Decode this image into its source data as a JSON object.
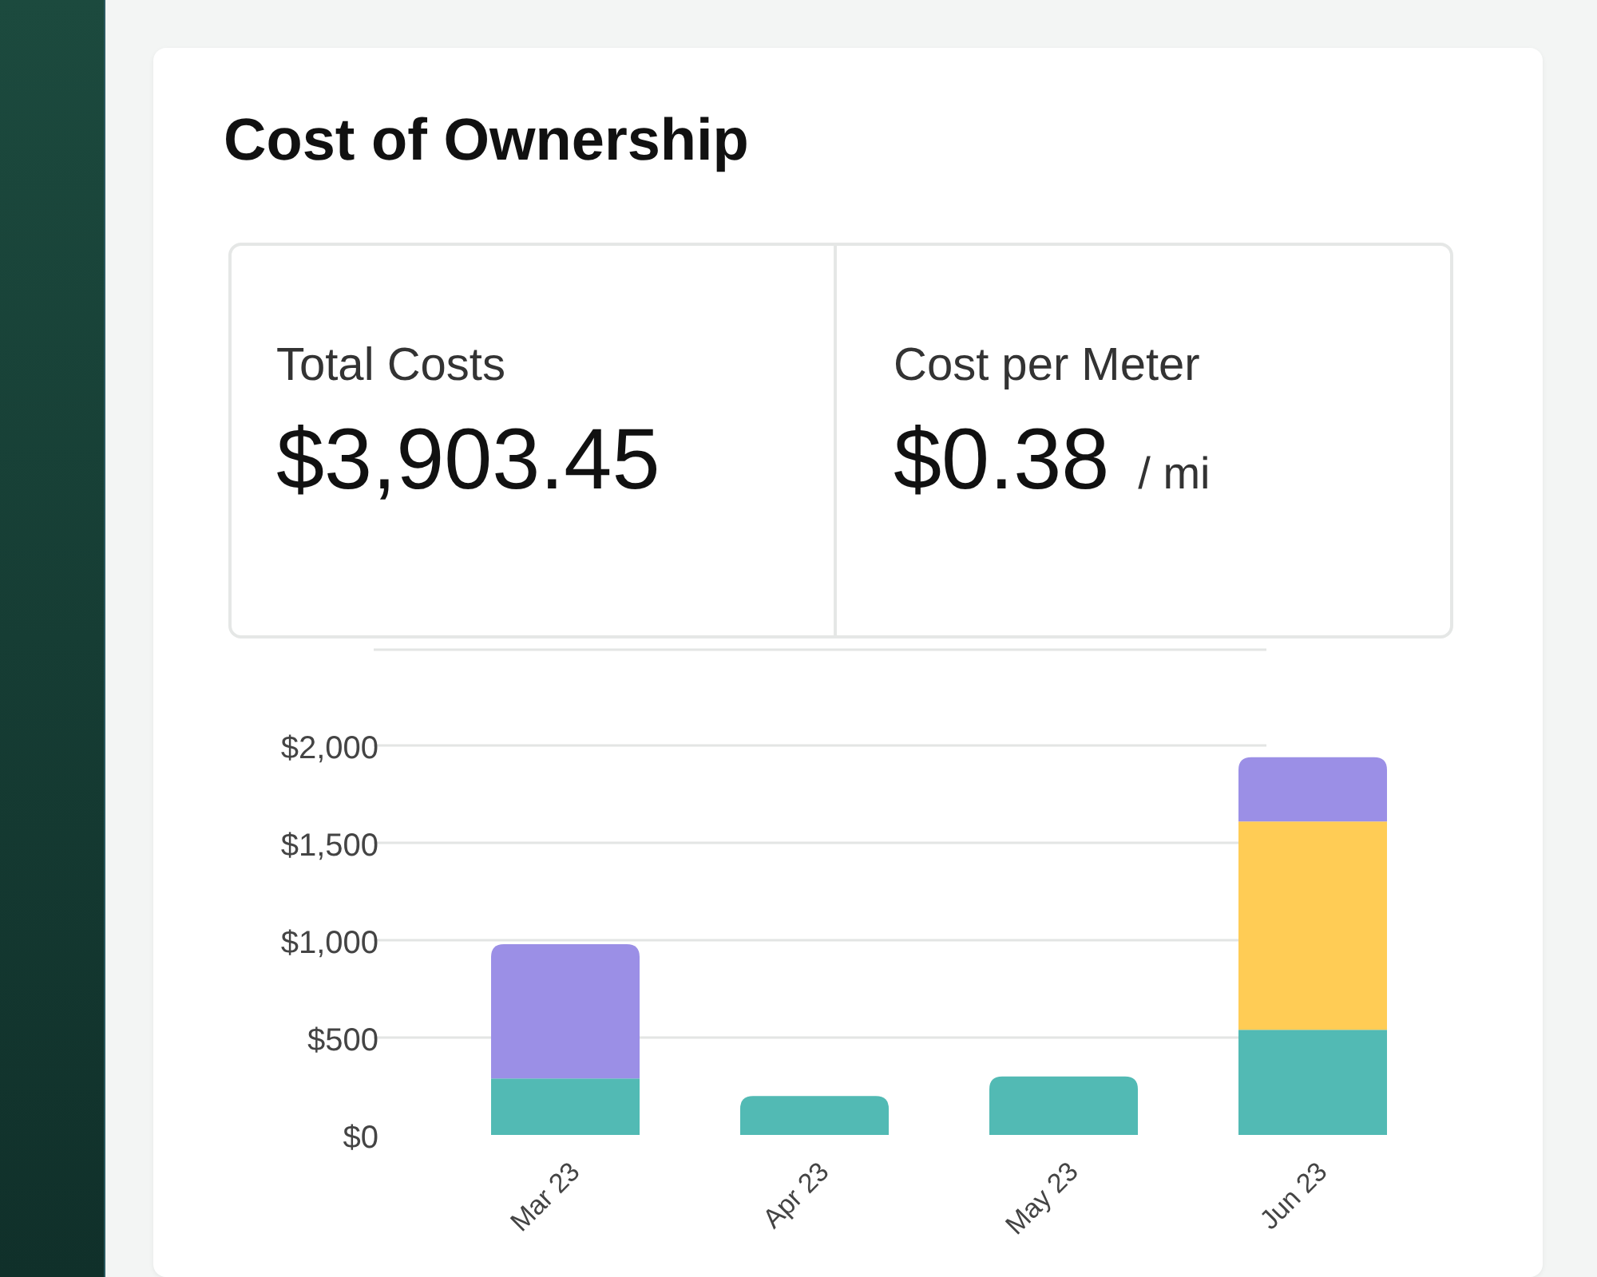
{
  "card": {
    "title": "Cost of Ownership",
    "stats": [
      {
        "label": "Total Costs",
        "value": "$3,903.45"
      },
      {
        "label": "Cost per Meter",
        "value": "$0.38",
        "unit": "/ mi"
      }
    ],
    "chart_data": {
      "type": "bar",
      "stacked": true,
      "categories": [
        "Mar 23",
        "Apr 23",
        "May 23",
        "Jun 23"
      ],
      "series": [
        {
          "color": "#52bab4",
          "values": [
            290,
            200,
            300,
            540
          ]
        },
        {
          "color": "#ffcc55",
          "values": [
            0,
            0,
            0,
            1070
          ]
        },
        {
          "color": "#9b8fe6",
          "values": [
            690,
            0,
            0,
            330
          ]
        }
      ],
      "grid": true,
      "ylim": [
        0,
        2000
      ],
      "yticks": [
        {
          "value": 0,
          "label": "$0"
        },
        {
          "value": 500,
          "label": "$500"
        },
        {
          "value": 1000,
          "label": "$1,000"
        },
        {
          "value": 1500,
          "label": "$1,500"
        },
        {
          "value": 2000,
          "label": "$2,000"
        }
      ]
    }
  }
}
